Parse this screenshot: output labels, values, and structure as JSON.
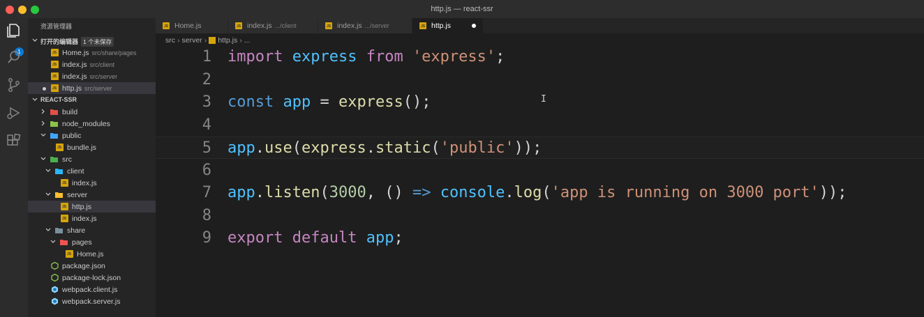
{
  "window": {
    "title": "http.js — react-ssr"
  },
  "activity_bar": {
    "explorer_badge": "1",
    "icons": [
      "files-icon",
      "search-icon",
      "source-control-icon",
      "debug-icon",
      "extensions-icon"
    ]
  },
  "sidebar": {
    "title": "资源管理器",
    "open_editors": {
      "label": "打开的编辑器",
      "badge": "1 个未保存",
      "items": [
        {
          "name": "Home.js",
          "path": "src/share/pages"
        },
        {
          "name": "index.js",
          "path": "src/client"
        },
        {
          "name": "index.js",
          "path": "src/server"
        },
        {
          "name": "http.js",
          "path": "src/server"
        }
      ]
    },
    "project": {
      "label": "REACT-SSR",
      "items": [
        "build",
        "node_modules",
        "public",
        "bundle.js",
        "src",
        "client",
        "index.js",
        "server",
        "http.js",
        "index.js",
        "share",
        "pages",
        "Home.js",
        "package.json",
        "package-lock.json",
        "webpack.client.js",
        "webpack.server.js"
      ]
    }
  },
  "tabs": [
    {
      "name": "Home.js",
      "desc": ""
    },
    {
      "name": "index.js",
      "desc": ".../client"
    },
    {
      "name": "index.js",
      "desc": ".../server"
    },
    {
      "name": "http.js",
      "desc": ""
    }
  ],
  "breadcrumb": [
    "src",
    "server",
    "http.js",
    "..."
  ],
  "editor": {
    "line_numbers": [
      "1",
      "2",
      "3",
      "4",
      "5",
      "6",
      "7",
      "8",
      "9"
    ],
    "current_line": 5,
    "lines": [
      [
        [
          "kw",
          "import"
        ],
        [
          "plain",
          " "
        ],
        [
          "var",
          "express"
        ],
        [
          "plain",
          " "
        ],
        [
          "kw",
          "from"
        ],
        [
          "plain",
          " "
        ],
        [
          "str",
          "'express'"
        ],
        [
          "plain",
          ";"
        ]
      ],
      [],
      [
        [
          "kwb",
          "const"
        ],
        [
          "plain",
          " "
        ],
        [
          "var",
          "app"
        ],
        [
          "plain",
          " = "
        ],
        [
          "fn",
          "express"
        ],
        [
          "plain",
          "();"
        ]
      ],
      [],
      [
        [
          "var",
          "app"
        ],
        [
          "plain",
          "."
        ],
        [
          "fn",
          "use"
        ],
        [
          "plain",
          "("
        ],
        [
          "fn",
          "express"
        ],
        [
          "plain",
          "."
        ],
        [
          "fn",
          "static"
        ],
        [
          "plain",
          "("
        ],
        [
          "str",
          "'public'"
        ],
        [
          "plain",
          "));"
        ]
      ],
      [],
      [
        [
          "var",
          "app"
        ],
        [
          "plain",
          "."
        ],
        [
          "fn",
          "listen"
        ],
        [
          "plain",
          "("
        ],
        [
          "num",
          "3000"
        ],
        [
          "plain",
          ", () "
        ],
        [
          "kwb",
          "=>"
        ],
        [
          "plain",
          " "
        ],
        [
          "var",
          "console"
        ],
        [
          "plain",
          "."
        ],
        [
          "fn",
          "log"
        ],
        [
          "plain",
          "("
        ],
        [
          "str",
          "'app is running on 3000 port'"
        ],
        [
          "plain",
          "));"
        ]
      ],
      [],
      [
        [
          "kw",
          "export"
        ],
        [
          "plain",
          " "
        ],
        [
          "kw",
          "default"
        ],
        [
          "plain",
          " "
        ],
        [
          "var",
          "app"
        ],
        [
          "plain",
          ";"
        ]
      ]
    ],
    "mouse_cursor": "I"
  },
  "colors": {
    "js_icon": "#d6a40b",
    "keyword": "#c586c0",
    "keyword_blue": "#569cd6",
    "variable": "#4fc1ff",
    "function": "#dcdcaa",
    "string": "#ce9178",
    "number": "#b5cea8"
  }
}
